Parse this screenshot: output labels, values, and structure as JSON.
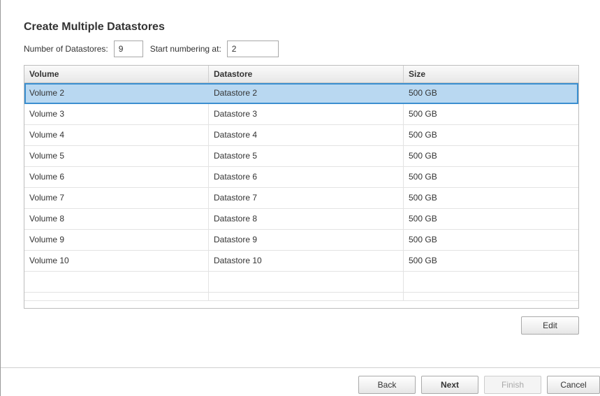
{
  "dialog": {
    "title": "Create Multiple Datastores"
  },
  "form": {
    "num_label": "Number of Datastores:",
    "num_value": "9",
    "start_label": "Start numbering at:",
    "start_value": "2"
  },
  "table": {
    "columns": [
      "Volume",
      "Datastore",
      "Size"
    ],
    "rows": [
      [
        "Volume 2",
        "Datastore 2",
        "500 GB"
      ],
      [
        "Volume 3",
        "Datastore 3",
        "500 GB"
      ],
      [
        "Volume 4",
        "Datastore 4",
        "500 GB"
      ],
      [
        "Volume 5",
        "Datastore 5",
        "500 GB"
      ],
      [
        "Volume 6",
        "Datastore 6",
        "500 GB"
      ],
      [
        "Volume 7",
        "Datastore 7",
        "500 GB"
      ],
      [
        "Volume 8",
        "Datastore 8",
        "500 GB"
      ],
      [
        "Volume 9",
        "Datastore 9",
        "500 GB"
      ],
      [
        "Volume 10",
        "Datastore 10",
        "500 GB"
      ]
    ],
    "selected_row": 0
  },
  "buttons": {
    "edit": "Edit",
    "back": "Back",
    "next": "Next",
    "finish": "Finish",
    "cancel": "Cancel"
  },
  "colors": {
    "selected_row_bg": "#b9d8f1",
    "selected_row_border": "#3b8fd0"
  }
}
